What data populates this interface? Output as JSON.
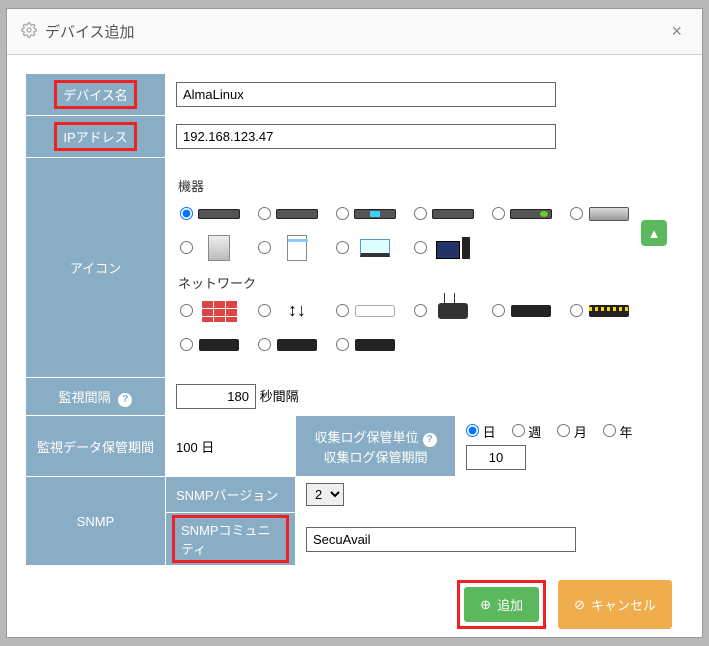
{
  "dialog": {
    "title": "デバイス追加"
  },
  "fields": {
    "device_name_label": "デバイス名",
    "device_name_value": "AlmaLinux",
    "ip_label": "IPアドレス",
    "ip_value": "192.168.123.47",
    "icon_label": "アイコン",
    "interval_label": "監視間隔",
    "interval_value": "180",
    "interval_unit": "秒間隔",
    "retention_label": "監視データ保管期間",
    "retention_value": "100 日",
    "log_unit_label": "収集ログ保管単位",
    "log_period_label": "収集ログ保管期間",
    "log_period_value": "10",
    "snmp_label": "SNMP",
    "snmp_version_label": "SNMPバージョン",
    "snmp_version_value": "2",
    "snmp_community_label": "SNMPコミュニティ",
    "snmp_community_value": "SecuAvail"
  },
  "icon_sections": {
    "device": "機器",
    "network": "ネットワーク"
  },
  "log_unit_options": {
    "day": "日",
    "week": "週",
    "month": "月",
    "year": "年",
    "selected": "day"
  },
  "buttons": {
    "add": "追加",
    "cancel": "キャンセル"
  }
}
